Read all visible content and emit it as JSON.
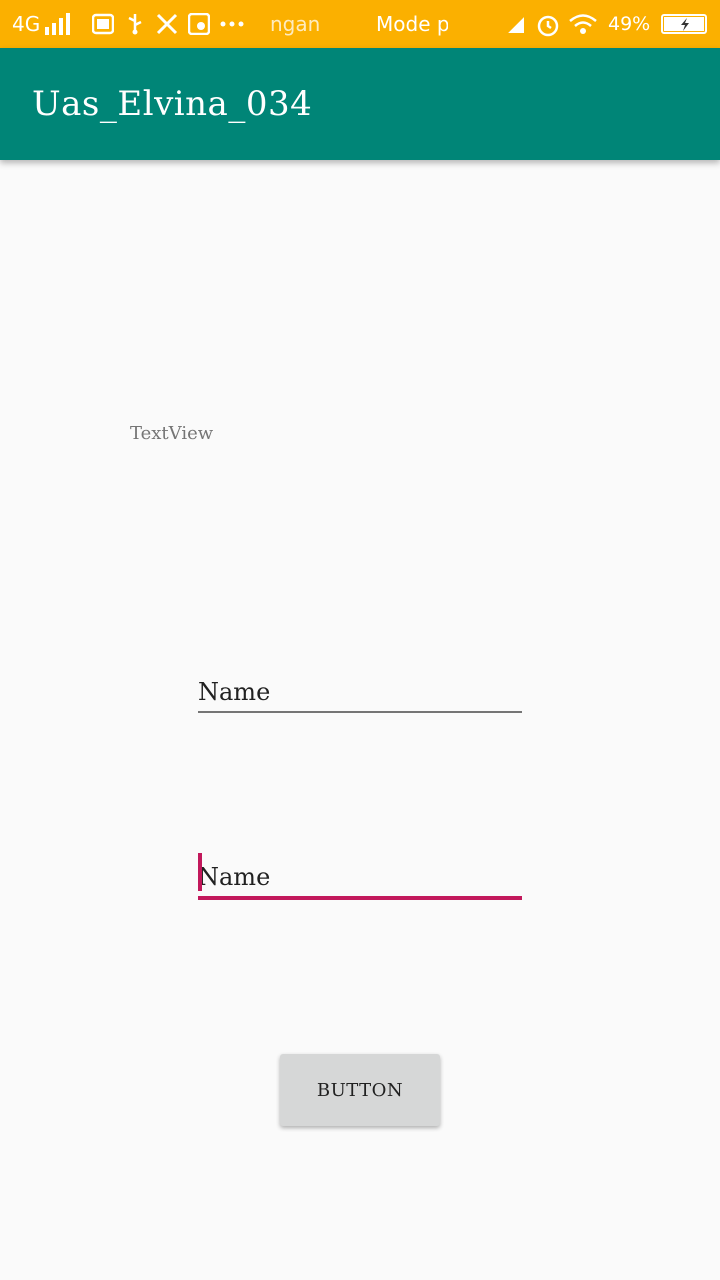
{
  "status_bar": {
    "network": "4G",
    "carrier_text": "ngan",
    "mode_text": "Mode p",
    "battery_percent": "49%",
    "icons": [
      "signal-icon",
      "sms-icon",
      "usb-icon",
      "tools-icon",
      "app-icon",
      "more-dots-icon",
      "muted-icon",
      "alarm-icon",
      "wifi-icon",
      "battery-charging-icon"
    ]
  },
  "app_bar": {
    "title": "Uas_Elvina_034",
    "color": "#008577"
  },
  "main": {
    "text_view": "TextView",
    "field1": {
      "placeholder": "Name"
    },
    "field2": {
      "placeholder": "Name",
      "accent": "#c2185b"
    },
    "button_label": "BUTTON"
  }
}
